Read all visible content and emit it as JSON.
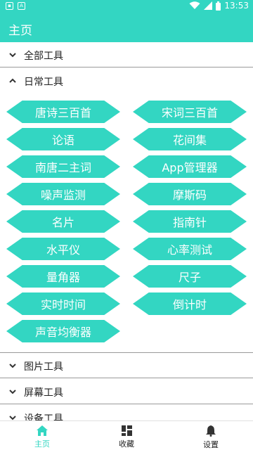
{
  "status_bar": {
    "time": "13:53",
    "left_icons": [
      "image-icon",
      "text-a-icon"
    ],
    "bg_color": "#33d6c2"
  },
  "app_bar": {
    "title": "主页"
  },
  "sections": {
    "all_tools": {
      "label": "全部工具",
      "expanded": false
    },
    "daily_tools": {
      "label": "日常工具",
      "expanded": true
    },
    "image_tools": {
      "label": "图片工具",
      "expanded": false
    },
    "screen_tools": {
      "label": "屏幕工具",
      "expanded": false
    },
    "device_tools": {
      "label": "设备工具",
      "expanded": false
    }
  },
  "daily_items": [
    "唐诗三百首",
    "宋词三百首",
    "论语",
    "花间集",
    "南唐二主词",
    "App管理器",
    "噪声监测",
    "摩斯码",
    "名片",
    "指南针",
    "水平仪",
    "心率测试",
    "量角器",
    "尺子",
    "实时时间",
    "倒计时",
    "声音均衡器"
  ],
  "bottom_nav": {
    "home": {
      "label": "主页",
      "active": true,
      "icon": "home-icon"
    },
    "favorites": {
      "label": "收藏",
      "active": false,
      "icon": "grid-icon"
    },
    "settings": {
      "label": "设置",
      "active": false,
      "icon": "bell-icon"
    }
  },
  "colors": {
    "accent": "#33d6c2"
  }
}
